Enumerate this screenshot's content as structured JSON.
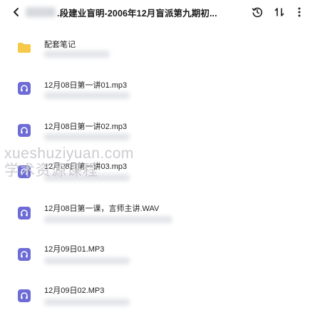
{
  "header": {
    "title": ".段建业盲明-2006年12月盲派第九期初...",
    "back_icon": "chevron-left-icon",
    "actions": [
      "history-icon",
      "sort-icon",
      "more-vertical-icon"
    ]
  },
  "files": [
    {
      "name": "配套笔记",
      "type": "folder",
      "icon": "folder-icon",
      "color": "#f7c948"
    },
    {
      "name": "12月08日第一讲01.mp3",
      "type": "audio",
      "icon": "audio-file-icon",
      "color": "#6d6cd6"
    },
    {
      "name": "12月08日第一讲02.mp3",
      "type": "audio",
      "icon": "audio-file-icon",
      "color": "#6d6cd6"
    },
    {
      "name": "12月08日第一讲03.mp3",
      "type": "audio",
      "icon": "audio-file-icon",
      "color": "#6d6cd6"
    },
    {
      "name": "12月08日第一课，言师主讲.WAV",
      "type": "audio",
      "icon": "audio-file-icon",
      "color": "#6d6cd6"
    },
    {
      "name": "12月09日01.MP3",
      "type": "audio",
      "icon": "audio-file-icon",
      "color": "#6d6cd6"
    },
    {
      "name": "12月09日02.MP3",
      "type": "audio",
      "icon": "audio-file-icon",
      "color": "#6d6cd6"
    }
  ],
  "watermark": {
    "line1": "xueshuziyuan.com",
    "line2": "学术资源课程"
  }
}
